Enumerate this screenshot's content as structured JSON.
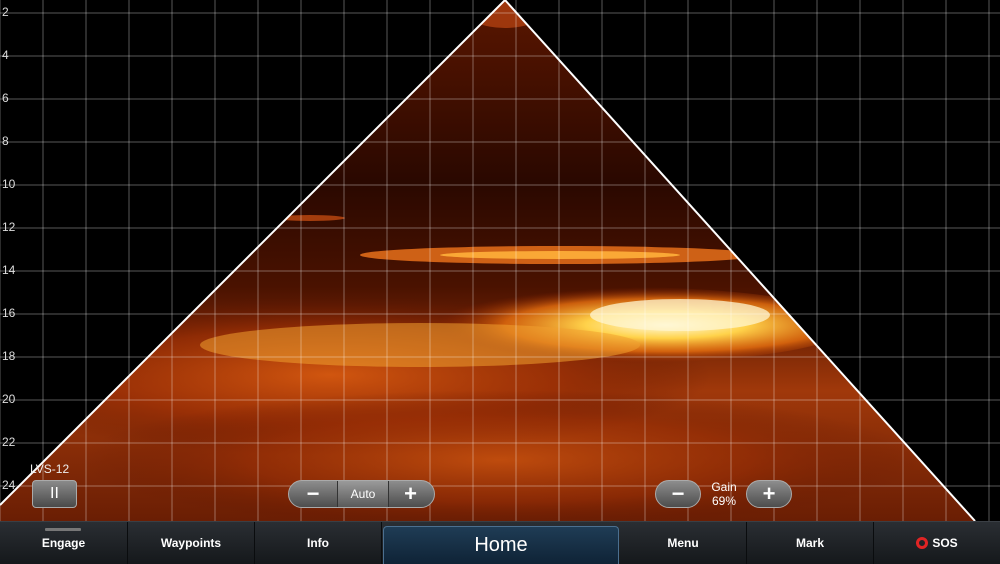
{
  "sonar": {
    "source_label": "LVS-12",
    "depth_labels": [
      "2",
      "4",
      "6",
      "8",
      "10",
      "12",
      "14",
      "16",
      "18",
      "20",
      "22",
      "24"
    ]
  },
  "controls": {
    "pause_label": "II",
    "range": {
      "minus": "−",
      "mode": "Auto",
      "plus": "+"
    },
    "gain": {
      "minus": "−",
      "label": "Gain",
      "value": "69%",
      "plus": "+"
    }
  },
  "nav": {
    "engage": "Engage",
    "waypoints": "Waypoints",
    "info": "Info",
    "home": "Home",
    "menu": "Menu",
    "mark": "Mark",
    "sos": "SOS"
  },
  "colors": {
    "echo_hot": "#fff2a0",
    "echo_mid": "#e86a10",
    "echo_low": "#6a1500",
    "background": "#000000",
    "sos": "#e02424"
  }
}
